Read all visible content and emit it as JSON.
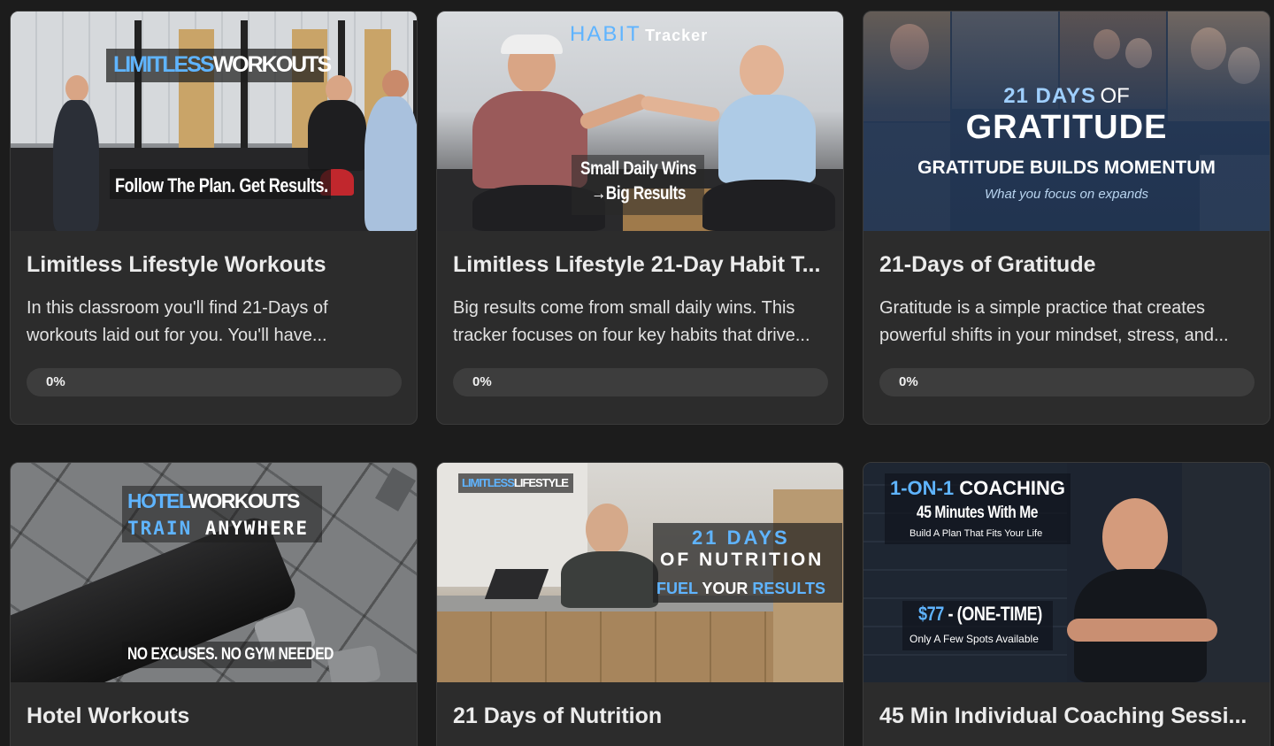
{
  "cards": [
    {
      "title": "Limitless Lifestyle Workouts",
      "description": "In this classroom you'll find 21-Days of workouts laid out for you. You'll have...",
      "progress_label": "0%",
      "progress_value": 0,
      "thumb": {
        "brand_a": "LIMITLESS",
        "brand_b": "WORKOUTS",
        "tagline": "Follow The Plan.  Get Results."
      }
    },
    {
      "title": "Limitless Lifestyle 21-Day Habit T...",
      "description": "Big results come from small daily wins. This tracker focuses on four key habits that drive...",
      "progress_label": "0%",
      "progress_value": 0,
      "thumb": {
        "word_a": "HABIT",
        "word_b": "Tracker",
        "line1": "Small Daily Wins",
        "line2": "→Big Results"
      }
    },
    {
      "title": "21-Days of Gratitude",
      "description": "Gratitude is a simple practice that creates powerful shifts in your mindset, stress, and...",
      "progress_label": "0%",
      "progress_value": 0,
      "thumb": {
        "line1a": "21 DAYS",
        "line1b": "OF",
        "line2": "GRATITUDE",
        "line3": "GRATITUDE BUILDS MOMENTUM",
        "line4": "What you focus on expands"
      }
    },
    {
      "title": "Hotel Workouts",
      "thumb": {
        "line1a": "HOTEL",
        "line1b": "WORKOUTS",
        "line2a": "TRAIN",
        "line2b": "ANYWHERE",
        "footer": "NO EXCUSES.  NO GYM NEEDED"
      }
    },
    {
      "title": "21 Days of Nutrition",
      "thumb": {
        "brand_a": "LIMITLESS",
        "brand_b": "LIFESTYLE",
        "line1": "21 DAYS",
        "line2": "OF NUTRITION",
        "line3a": "FUEL",
        "line3b": "YOUR",
        "line3c": "RESULTS"
      }
    },
    {
      "title": "45 Min Individual Coaching Sessi...",
      "thumb": {
        "line1a": "1-ON-1",
        "line1b": "COACHING",
        "line2": "45 Minutes With Me",
        "line3": "Build A Plan That Fits Your Life",
        "price_a": "$77",
        "price_b": " - (ONE-TIME)",
        "spots": "Only A Few Spots Available"
      }
    }
  ],
  "colors": {
    "background": "#1c1c1c",
    "card": "#2c2c2c",
    "progress_track": "#3d3d3d",
    "accent_blue": "#5fb4ff"
  }
}
